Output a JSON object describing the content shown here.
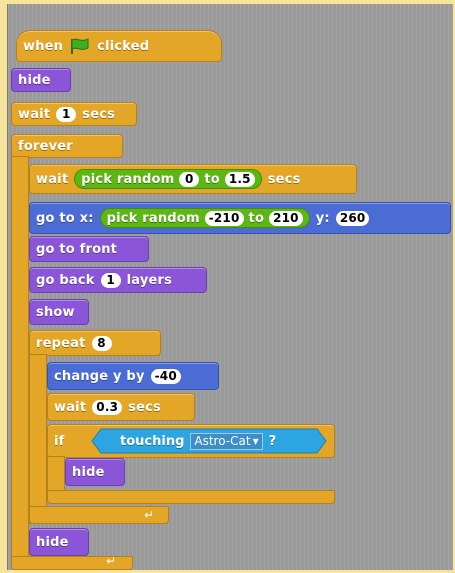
{
  "script": {
    "hat": {
      "when": "when",
      "clicked": "clicked"
    },
    "hide1": "hide",
    "wait1": {
      "label": "wait",
      "value": "1",
      "unit": "secs"
    },
    "forever": "forever",
    "wait_random": {
      "label": "wait",
      "op": "pick random",
      "from": "0",
      "to_label": "to",
      "to": "1.5",
      "unit": "secs"
    },
    "goto": {
      "label": "go to x:",
      "op": "pick random",
      "from": "-210",
      "to_label": "to",
      "to": "210",
      "y_label": "y:",
      "y": "260"
    },
    "front": "go to front",
    "goback": {
      "label": "go back",
      "value": "1",
      "unit": "layers"
    },
    "show": "show",
    "repeat": {
      "label": "repeat",
      "value": "8"
    },
    "changey": {
      "label": "change y by",
      "value": "-40"
    },
    "wait03": {
      "label": "wait",
      "value": "0.3",
      "unit": "secs"
    },
    "if": {
      "label": "if",
      "touching": "touching",
      "target": "Astro-Cat",
      "q": "?"
    },
    "hide2": "hide",
    "hide3": "hide"
  },
  "icons": {
    "flag": "green-flag-icon",
    "loop": "loop-arrow-icon",
    "dropdown": "dropdown-arrow-icon"
  },
  "colors": {
    "control": "#e4a626",
    "looks": "#8a55d7",
    "motion": "#4a6cd4",
    "operators": "#5cb712",
    "sensing": "#2ca5e2"
  }
}
